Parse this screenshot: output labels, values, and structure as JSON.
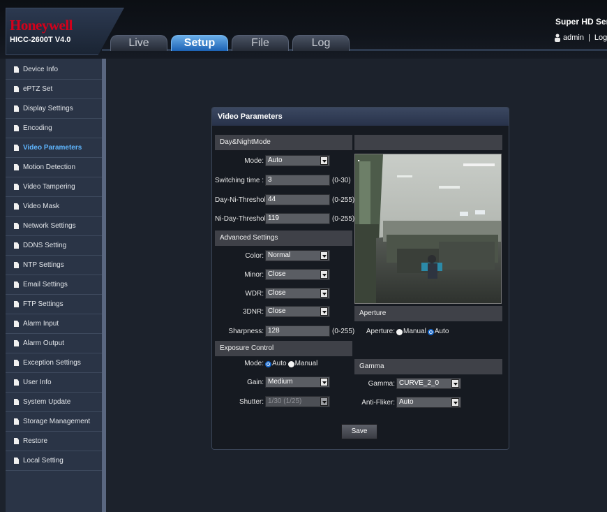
{
  "header": {
    "brand": "Honeywell",
    "model": "HICC-2600T V4.0",
    "product_title": "Super HD Series",
    "user": "admin",
    "logout": "Logout",
    "tabs": [
      {
        "label": "Live"
      },
      {
        "label": "Setup"
      },
      {
        "label": "File"
      },
      {
        "label": "Log"
      }
    ]
  },
  "sidebar": {
    "items": [
      {
        "label": "Device Info"
      },
      {
        "label": "ePTZ Set"
      },
      {
        "label": "Display Settings"
      },
      {
        "label": "Encoding"
      },
      {
        "label": "Video Parameters"
      },
      {
        "label": "Motion Detection"
      },
      {
        "label": "Video Tampering"
      },
      {
        "label": "Video Mask"
      },
      {
        "label": "Network Settings"
      },
      {
        "label": "DDNS Setting"
      },
      {
        "label": "NTP Settings"
      },
      {
        "label": "Email Settings"
      },
      {
        "label": "FTP Settings"
      },
      {
        "label": "Alarm Input"
      },
      {
        "label": "Alarm Output"
      },
      {
        "label": "Exception Settings"
      },
      {
        "label": "User Info"
      },
      {
        "label": "System Update"
      },
      {
        "label": "Storage Management"
      },
      {
        "label": "Restore"
      },
      {
        "label": "Local Setting"
      }
    ],
    "active_index": 4
  },
  "panel": {
    "title": "Video Parameters",
    "day_night": {
      "header": "Day&NightMode",
      "mode_label": "Mode:",
      "mode_value": "Auto",
      "switching_label": "Switching time :",
      "switching_value": "3",
      "switching_range": "(0-30)",
      "dn_label": "Day-Ni-Threshold :",
      "dn_value": "44",
      "dn_range": "(0-255)",
      "nd_label": "Ni-Day-Threshold:",
      "nd_value": "119",
      "nd_range": "(0-255)"
    },
    "advanced": {
      "header": "Advanced Settings",
      "color_label": "Color:",
      "color_value": "Normal",
      "minor_label": "Minor:",
      "minor_value": "Close",
      "wdr_label": "WDR:",
      "wdr_value": "Close",
      "dnr_label": "3DNR:",
      "dnr_value": "Close",
      "sharpness_label": "Sharpness:",
      "sharpness_value": "128",
      "sharpness_range": "(0-255)"
    },
    "exposure": {
      "header": "Exposure Control",
      "mode_label": "Mode:",
      "mode_auto": "Auto",
      "mode_manual": "Manual",
      "gain_label": "Gain:",
      "gain_value": "Medium",
      "shutter_label": "Shutter:",
      "shutter_value": "1/30 (1/25)"
    },
    "aperture": {
      "header": "Aperture",
      "label": "Aperture:",
      "manual": "Manual",
      "auto": "Auto"
    },
    "gamma": {
      "header": "Gamma",
      "gamma_label": "Gamma:",
      "gamma_value": "CURVE_2_0",
      "flicker_label": "Anti-Fliker:",
      "flicker_value": "Auto"
    },
    "save_label": "Save"
  }
}
